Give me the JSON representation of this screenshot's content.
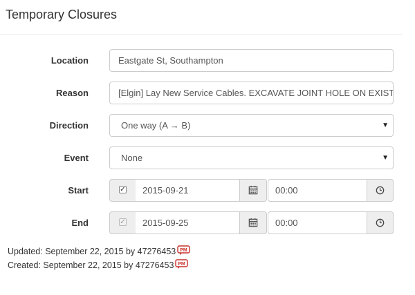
{
  "page": {
    "title": "Temporary Closures"
  },
  "form": {
    "location": {
      "label": "Location",
      "value": "Eastgate St, Southampton"
    },
    "reason": {
      "label": "Reason",
      "value": "[Elgin] Lay New Service Cables. EXCAVATE JOINT HOLE ON EXISTI"
    },
    "direction": {
      "label": "Direction",
      "selected": "One way (A → B)"
    },
    "event": {
      "label": "Event",
      "selected": "None"
    },
    "start": {
      "label": "Start",
      "checked": true,
      "date": "2015-09-21",
      "time": "00:00"
    },
    "end": {
      "label": "End",
      "checked": true,
      "disabled": true,
      "date": "2015-09-25",
      "time": "00:00"
    }
  },
  "meta": {
    "updated": "Updated: September 22, 2015 by 47276453",
    "created": "Created: September 22, 2015 by 47276453",
    "pm_label": "PM"
  },
  "icons": {
    "select_caret": "caret-down-icon",
    "calendar": "calendar-icon",
    "clock": "clock-icon",
    "pm": "pm-message-icon"
  },
  "colors": {
    "addon_bg": "#eeeeee",
    "border": "#cccccc",
    "pm_badge": "#c9302c"
  }
}
